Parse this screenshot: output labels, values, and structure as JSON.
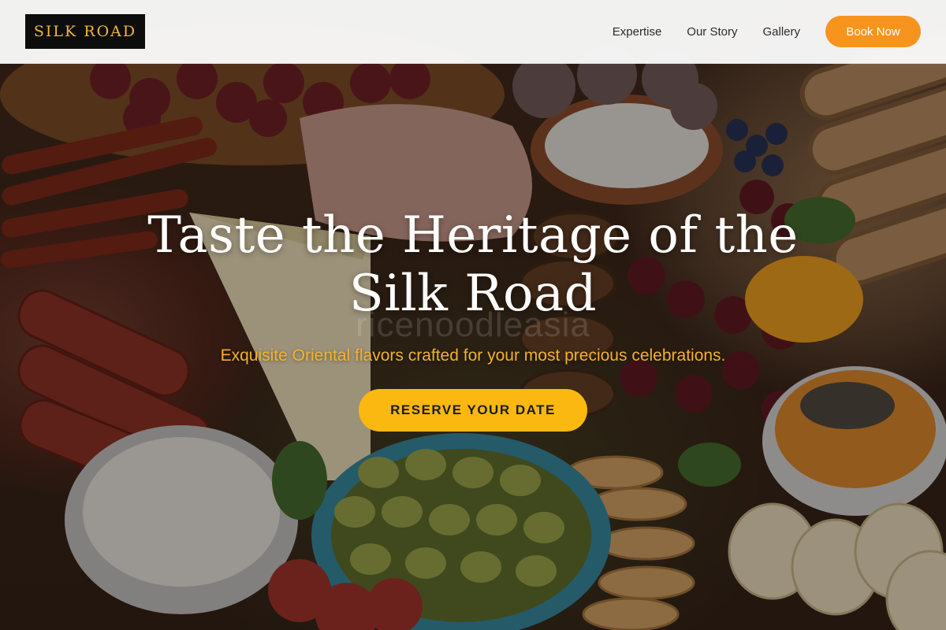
{
  "brand": {
    "logo_text": "SILK ROAD"
  },
  "nav": {
    "links": [
      "Expertise",
      "Our Story",
      "Gallery"
    ],
    "cta_label": "Book Now"
  },
  "hero": {
    "title_line1": "Taste the Heritage of the",
    "title_line2": "Silk Road",
    "watermark": "ricenoodleasia",
    "subtitle": "Exquisite Oriental flavors crafted for your most precious celebrations.",
    "cta_label": "RESERVE YOUR DATE",
    "background_subject": "charcuterie-platter-photo"
  },
  "colors": {
    "header_bg": "#fafafa",
    "logo_bg": "#0d0d0d",
    "logo_text": "#f0b73a",
    "book_button": "#f7941d",
    "cta_button": "#fbb810",
    "subtitle": "#f3b32a"
  }
}
